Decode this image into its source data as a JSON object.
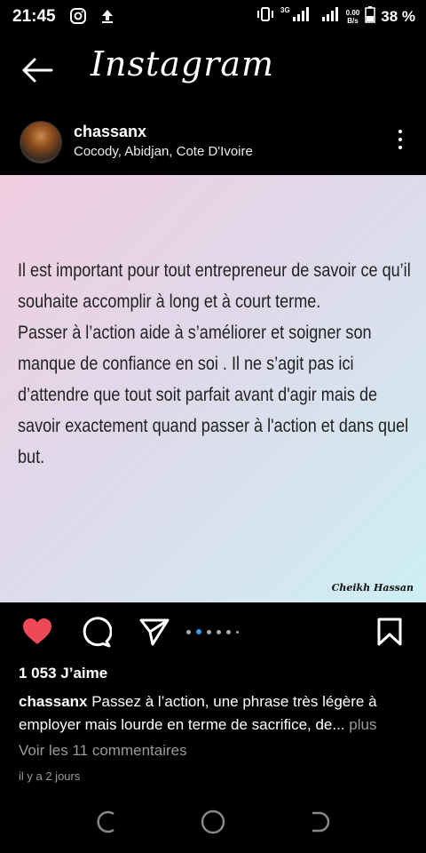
{
  "status": {
    "time": "21:45",
    "network_top": "0.00",
    "network_bottom": "B/s",
    "battery": "38 %",
    "net_type": "3G"
  },
  "header": {
    "title": "Instagram"
  },
  "post": {
    "username": "chassanx",
    "location": "Cocody, Abidjan, Cote D'Ivoire",
    "image_text": [
      " Il est important pour tout entrepreneur de savoir ce qu’il souhaite accomplir à long et à court terme.",
      "Passer à l’action aide à s’améliorer et soigner son manque de confiance en soi . Il ne s’agit pas ici d’attendre que tout soit parfait avant d'agir mais de savoir exactement quand passer à l'action et dans quel but."
    ],
    "signature": "Cheikh Hassan",
    "likes": "1 053 J’aime",
    "caption_user": "chassanx",
    "caption_text": " Passez à l’action, une phrase très légère à employer mais lourde en terme de sacrifice, de...",
    "caption_more": " plus",
    "comments": "Voir les 11 commentaires",
    "time_ago": "il y a 2 jours"
  },
  "colors": {
    "heart": "#ed4956",
    "dot_active": "#3897f0"
  },
  "icons": [
    "instagram-icon",
    "upload-icon",
    "vibrate-icon",
    "signal-icon",
    "battery-icon",
    "back-arrow-icon",
    "more-icon",
    "heart-icon",
    "comment-icon",
    "share-icon",
    "bookmark-icon",
    "recent-apps-icon",
    "home-icon",
    "back-nav-icon"
  ]
}
